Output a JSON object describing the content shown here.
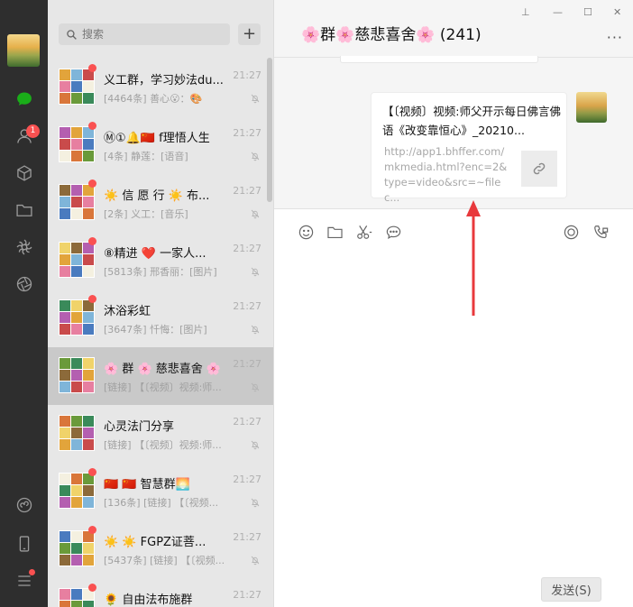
{
  "accent_color": "#fa5151",
  "nav": {
    "items": [
      "chat-icon",
      "contacts-icon",
      "favorites-cube-icon",
      "files-folder-icon",
      "moments-icon",
      "channels-aperture-icon",
      "mini-programs-icon",
      "phone-icon",
      "menu-icon"
    ],
    "contacts_badge": "1"
  },
  "search": {
    "placeholder": "搜索"
  },
  "add_label": "+",
  "chats": [
    {
      "title": "义工群，学习妙法du...",
      "time": "21:27",
      "preview": "[4464条] 善心😮：🎨",
      "unread_dot": true
    },
    {
      "title": "Ⓜ①🔔🇨🇳 f理悟人生",
      "time": "21:27",
      "preview": "[4条] 静莲：[语音]",
      "unread_dot": true
    },
    {
      "title": "☀️ 信 愿 行 ☀️ 布...",
      "time": "21:27",
      "preview": "[2条] 义工：[音乐]",
      "unread_dot": true
    },
    {
      "title": "⑧精进 ❤️ 一家人...",
      "time": "21:27",
      "preview": "[5813条] 邢香丽：[图片]",
      "unread_dot": true
    },
    {
      "title": "沐浴彩虹",
      "time": "21:27",
      "preview": "[3647条] 忏悔：[图片]",
      "unread_dot": true
    },
    {
      "title": "🌸 群 🌸 慈悲喜舍 🌸",
      "time": "21:27",
      "preview": "[链接] 【〔视频〕视频:师...",
      "unread_dot": false,
      "active": true
    },
    {
      "title": "心灵法门分享",
      "time": "21:27",
      "preview": "[链接] 【〔视频〕视频:师...",
      "unread_dot": false
    },
    {
      "title": "🇨🇳 🇨🇳 智慧群🌅",
      "time": "21:27",
      "preview": "[136条] [链接] 【〔视频...",
      "unread_dot": true
    },
    {
      "title": "☀️ ☀️ FGPZ证菩...",
      "time": "21:27",
      "preview": "[5437条] [链接] 【〔视频...",
      "unread_dot": true
    },
    {
      "title": "🌻 自由法布施群",
      "time": "21:27",
      "preview": "",
      "unread_dot": true
    }
  ],
  "chat": {
    "title": "🌸群🌸慈悲喜舍🌸 (241)",
    "more_label": "···",
    "window_controls": [
      "⊥",
      "—",
      "☐",
      "✕"
    ],
    "message": {
      "title": "【〔视频〕视频:师父开示每日佛言佛语《改变靠恒心》_20210...",
      "url": "http://app1.bhffer.com/mkmedia.html?enc=2&type=video&src=~filec..."
    },
    "send_label": "发送(S)",
    "composer_value": ""
  }
}
